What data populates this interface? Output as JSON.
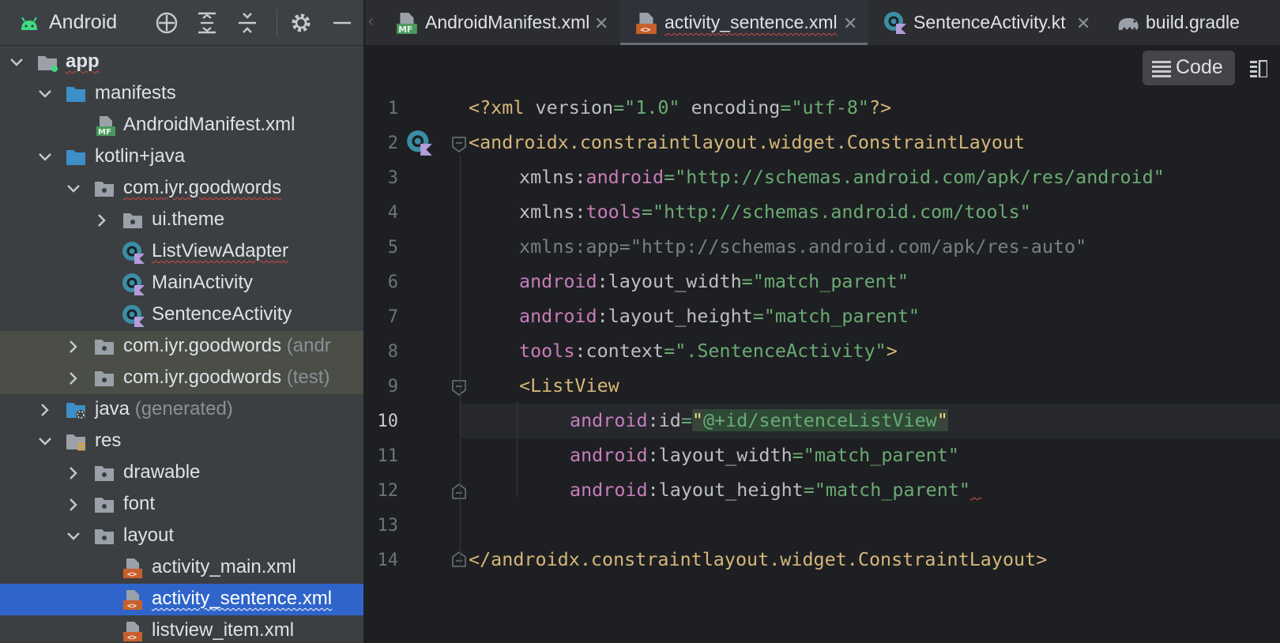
{
  "project": {
    "title": "Android",
    "tree": [
      {
        "label": "app",
        "suffix": ""
      },
      {
        "label": "manifests",
        "suffix": ""
      },
      {
        "label": "AndroidManifest.xml",
        "suffix": ""
      },
      {
        "label": "kotlin+java",
        "suffix": ""
      },
      {
        "label": "com.iyr.goodwords",
        "suffix": ""
      },
      {
        "label": "ui.theme",
        "suffix": ""
      },
      {
        "label": "ListViewAdapter",
        "suffix": ""
      },
      {
        "label": "MainActivity",
        "suffix": ""
      },
      {
        "label": "SentenceActivity",
        "suffix": ""
      },
      {
        "label": "com.iyr.goodwords ",
        "suffix": "(andr"
      },
      {
        "label": "com.iyr.goodwords ",
        "suffix": "(test)"
      },
      {
        "label": "java ",
        "suffix": "(generated)"
      },
      {
        "label": "res",
        "suffix": ""
      },
      {
        "label": "drawable",
        "suffix": ""
      },
      {
        "label": "font",
        "suffix": ""
      },
      {
        "label": "layout",
        "suffix": ""
      },
      {
        "label": "activity_main.xml",
        "suffix": ""
      },
      {
        "label": "activity_sentence.xml",
        "suffix": ""
      },
      {
        "label": "listview_item.xml",
        "suffix": ""
      }
    ]
  },
  "tabs": [
    {
      "label": "AndroidManifest.xml",
      "close": "✕"
    },
    {
      "label": "activity_sentence.xml",
      "close": "✕"
    },
    {
      "label": "SentenceActivity.kt",
      "close": "✕"
    },
    {
      "label": "build.gradle",
      "close": ""
    }
  ],
  "toolbar": {
    "code_label": "Code"
  },
  "editor": {
    "line_numbers": [
      "1",
      "2",
      "3",
      "4",
      "5",
      "6",
      "7",
      "8",
      "9",
      "10",
      "11",
      "12",
      "13",
      "14"
    ],
    "tokens": {
      "l1_a": "<?xml ",
      "l1_b": "version",
      "l1_c": "=",
      "l1_d": "\"1.0\"",
      "l1_e": " encoding",
      "l1_f": "=",
      "l1_g": "\"utf-8\"",
      "l1_h": "?>",
      "l2": "<androidx.constraintlayout.widget.ConstraintLayout",
      "l3_a": "xmlns:",
      "l3_b": "android",
      "l3_c": "=",
      "l3_d": "\"http://schemas.android.com/apk/res/android\"",
      "l4_a": "xmlns:",
      "l4_b": "tools",
      "l4_c": "=",
      "l4_d": "\"http://schemas.android.com/tools\"",
      "l5": "xmlns:app=\"http://schemas.android.com/apk/res-auto\"",
      "l6_a": "android",
      "l6_b": ":layout_width",
      "l6_c": "=",
      "l6_d": "\"match_parent\"",
      "l7_a": "android",
      "l7_b": ":layout_height",
      "l7_c": "=",
      "l7_d": "\"match_parent\"",
      "l8_a": "tools",
      "l8_b": ":context",
      "l8_c": "=",
      "l8_d": "\".SentenceActivity\"",
      "l8_e": ">",
      "l9": "<ListView",
      "l10_a": "android",
      "l10_b": ":id",
      "l10_c": "=",
      "l10_q1": "\"",
      "l10_d": "@+id/sentenceListView",
      "l10_q2": "\"",
      "l11_a": "android",
      "l11_b": ":layout_width",
      "l11_c": "=",
      "l11_d": "\"match_parent\"",
      "l12_a": "android",
      "l12_b": ":layout_height",
      "l12_c": "=",
      "l12_d": "\"match_parent\"",
      "l14": "</androidx.constraintlayout.widget.ConstraintLayout>"
    }
  },
  "colors": {
    "selection": "#2f65ca",
    "tag": "#d5b778",
    "string": "#6aab73",
    "namespace": "#c77dbb"
  }
}
